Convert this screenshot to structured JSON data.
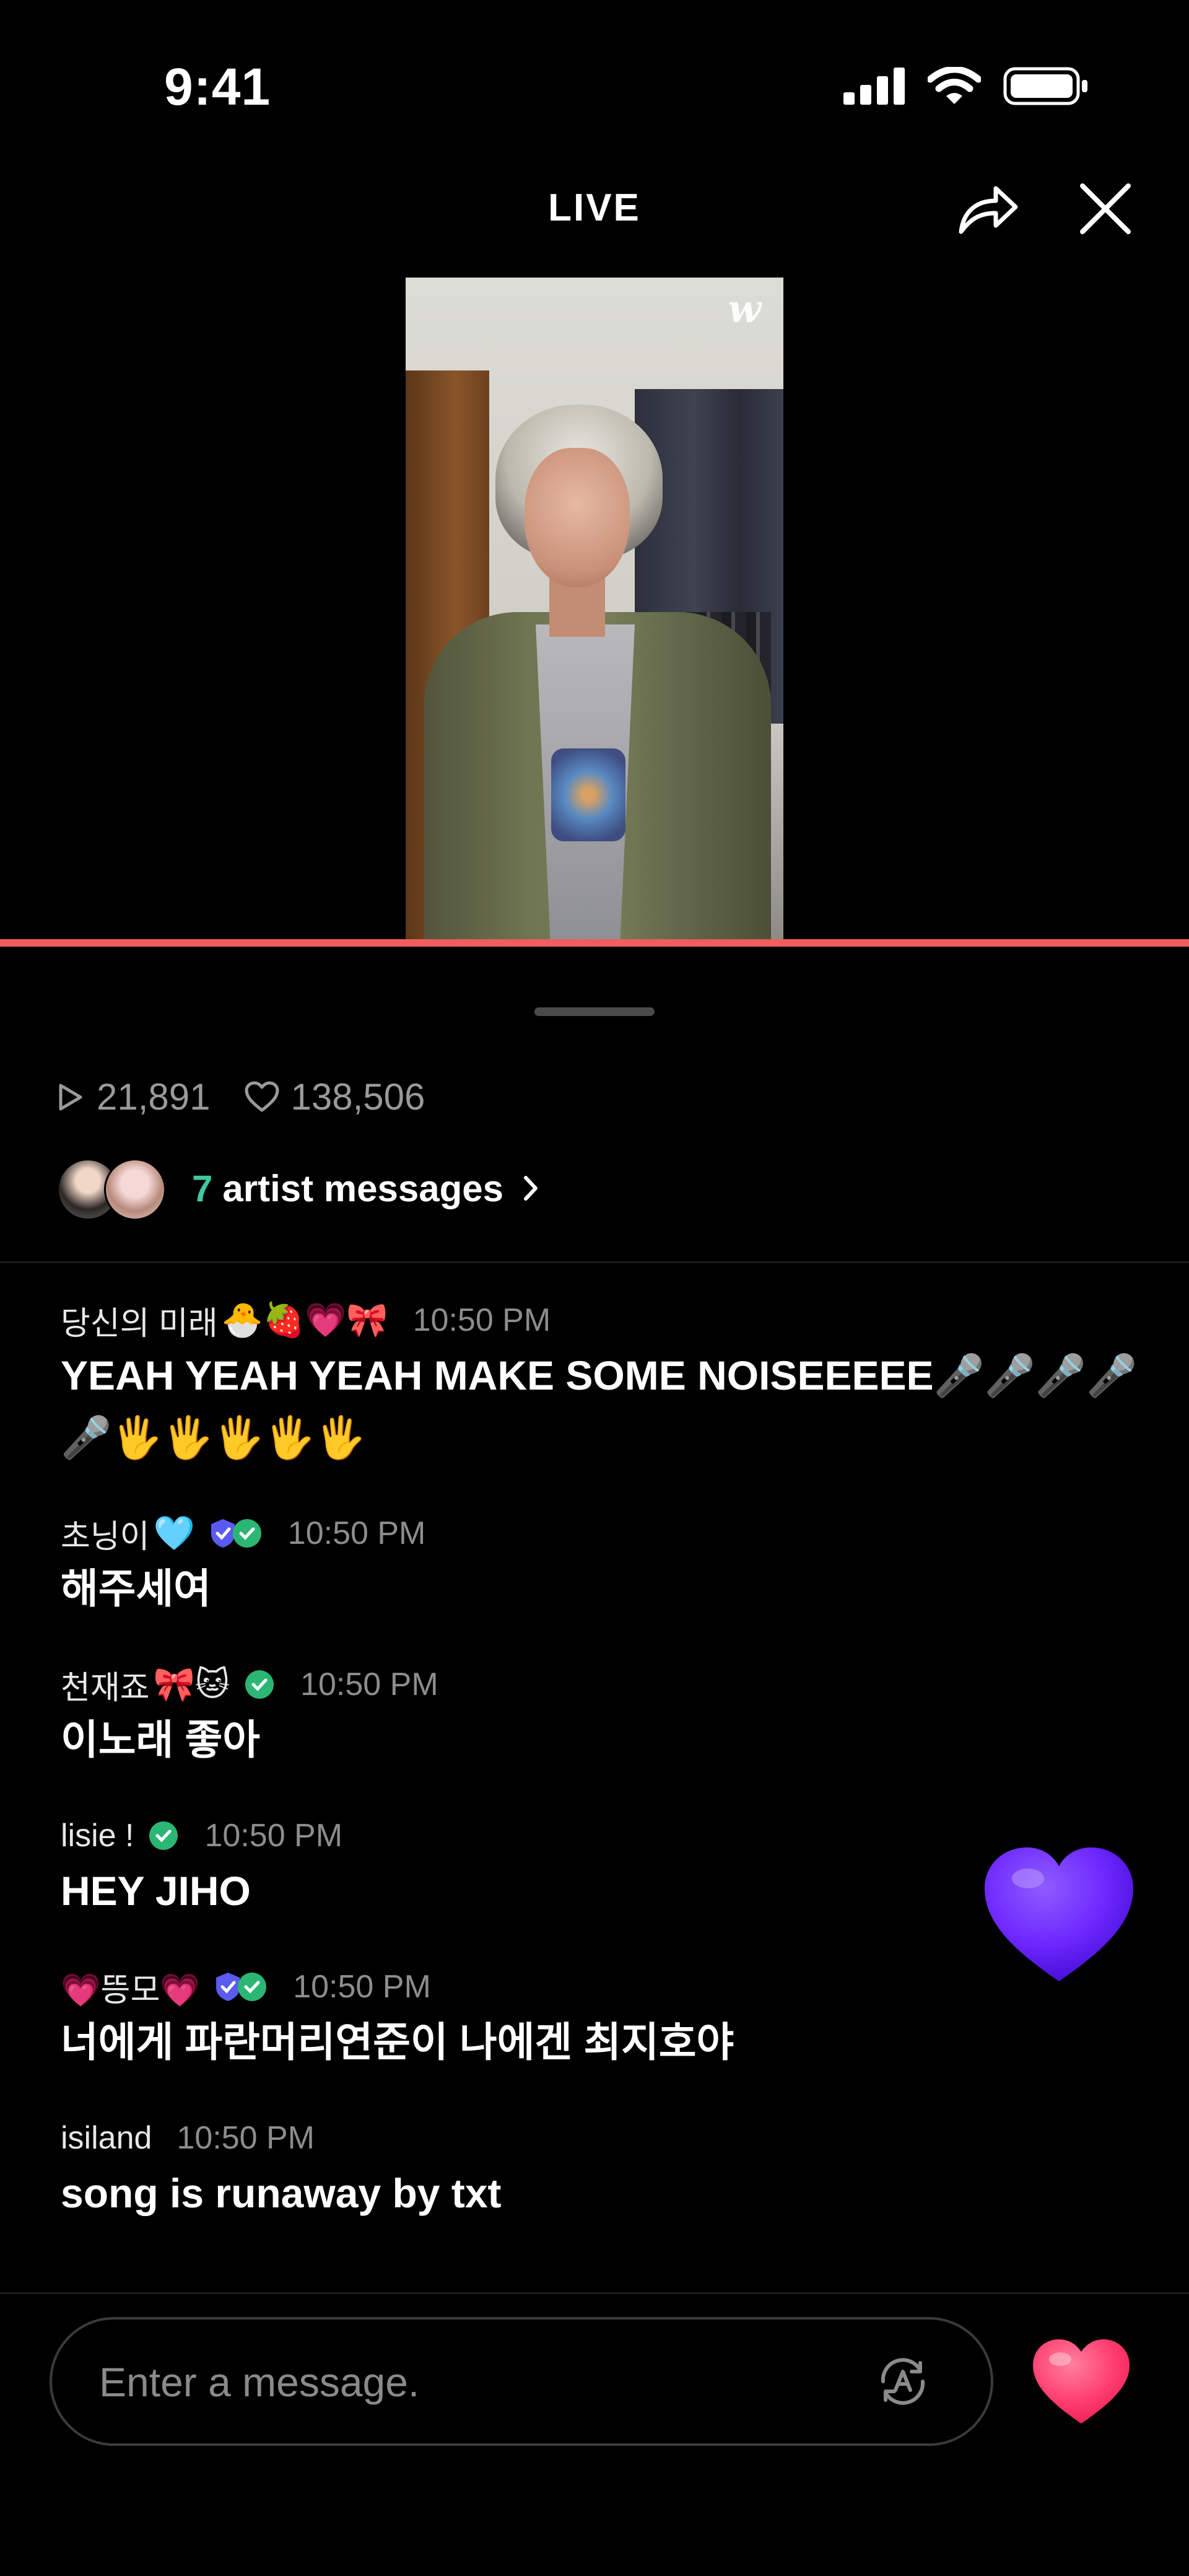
{
  "status_bar": {
    "time": "9:41"
  },
  "header": {
    "title": "LIVE"
  },
  "video": {
    "watermark": "w",
    "progress_color": "#f25d5d"
  },
  "stats": {
    "views": "21,891",
    "likes": "138,506"
  },
  "artist_messages": {
    "count": "7",
    "label": "artist messages"
  },
  "chat": [
    {
      "user": "당신의 미래",
      "emoji": "🐣🍓💗🎀",
      "badges": [],
      "time": "10:50 PM",
      "text": "YEAH YEAH YEAH MAKE SOME NOISEEEEE🎤🎤🎤🎤🎤🖐️🖐️🖐️🖐️🖐️"
    },
    {
      "user": "초닝이",
      "emoji": "🩵",
      "badges": [
        "purple",
        "green"
      ],
      "time": "10:50 PM",
      "text": "해주세여"
    },
    {
      "user": "천재죠",
      "emoji": "🎀🐱",
      "badges": [
        "green"
      ],
      "time": "10:50 PM",
      "text": "이노래 좋아"
    },
    {
      "user": "lisie !",
      "emoji": "",
      "badges": [
        "green"
      ],
      "time": "10:50 PM",
      "text": "HEY JIHO"
    },
    {
      "user": "💗뜽모💗",
      "emoji": "",
      "badges": [
        "purple",
        "green"
      ],
      "time": "10:50 PM",
      "text": "너에게 파란머리연준이 나에겐 최지호야"
    },
    {
      "user": "isiland",
      "emoji": "",
      "badges": [],
      "time": "10:50 PM",
      "text": "song is runaway by txt"
    }
  ],
  "composer": {
    "placeholder": "Enter a message."
  },
  "colors": {
    "accent_teal": "#3fc8a2",
    "like_pink": "#ff3d6e",
    "float_heart": "#6d28ff",
    "badge_green": "#2bb673",
    "badge_purple": "#5b5bf0"
  },
  "icons": {
    "views": "play-outline-icon",
    "likes": "heart-outline-icon",
    "share": "share-arrow-icon",
    "close": "close-icon",
    "translate": "translate-icon",
    "like": "heart-filled-icon"
  }
}
